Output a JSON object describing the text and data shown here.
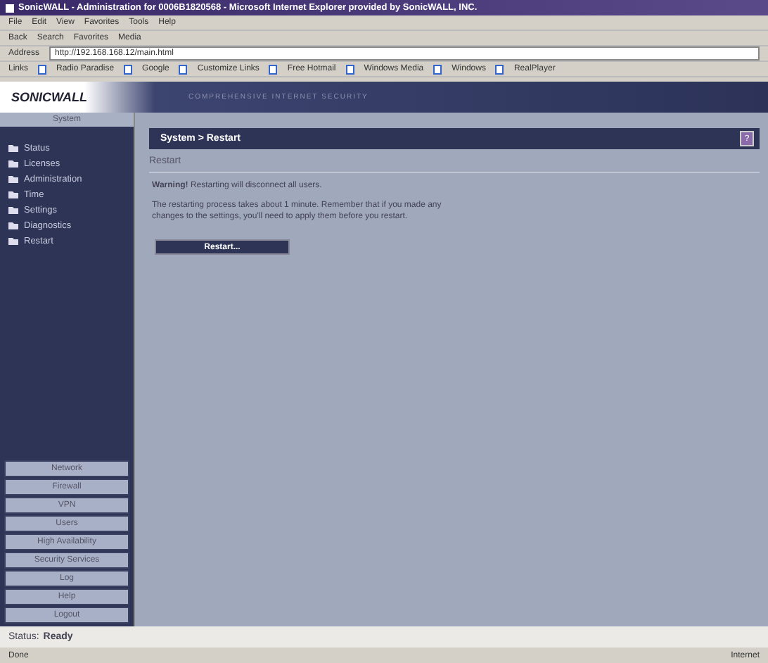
{
  "window": {
    "title": "SonicWALL - Administration for 0006B1820568 - Microsoft Internet Explorer provided by SonicWALL, INC."
  },
  "menu": [
    "File",
    "Edit",
    "View",
    "Favorites",
    "Tools",
    "Help"
  ],
  "toolbar": [
    "Back",
    "Search",
    "Favorites",
    "Media"
  ],
  "address": {
    "label": "Address",
    "value": "http://192.168.168.12/main.html"
  },
  "links": {
    "label": "Links",
    "items": [
      "Radio Paradise",
      "Google",
      "Customize Links",
      "Free Hotmail",
      "Windows Media",
      "Windows",
      "RealPlayer"
    ]
  },
  "banner": {
    "logo": "SONICWALL",
    "tagline": "COMPREHENSIVE INTERNET SECURITY"
  },
  "sidebar": {
    "section": "System",
    "items": [
      {
        "label": "Status"
      },
      {
        "label": "Licenses"
      },
      {
        "label": "Administration"
      },
      {
        "label": "Time"
      },
      {
        "label": "Settings"
      },
      {
        "label": "Diagnostics"
      },
      {
        "label": "Restart"
      }
    ],
    "nav": [
      "Network",
      "Firewall",
      "VPN",
      "Users",
      "High Availability",
      "Security Services",
      "Log",
      "Help",
      "Logout"
    ]
  },
  "content": {
    "breadcrumb": "System > Restart",
    "help": "?",
    "heading": "Restart",
    "warning": "**Warning!** Restarting will disconnect all users.",
    "info": "The restarting process takes about 1 minute. Remember that if you made any changes to the settings, you'll need to apply them before you restart.",
    "button": "Restart..."
  },
  "status": {
    "label": "Status:",
    "value": "Ready"
  },
  "ie_status": {
    "text": "Done",
    "zone": "Internet"
  }
}
